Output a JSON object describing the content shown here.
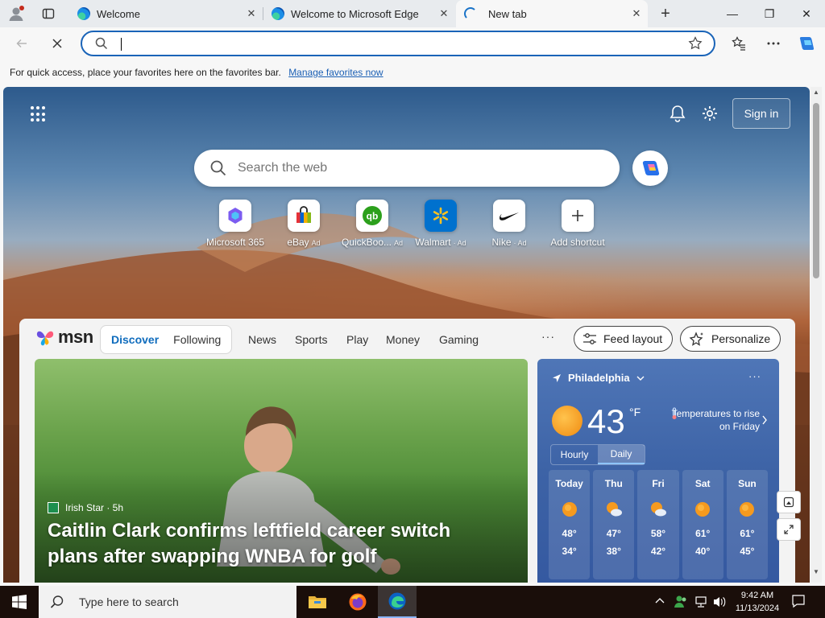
{
  "browser": {
    "tabs": [
      {
        "label": "Welcome"
      },
      {
        "label": "Welcome to Microsoft Edge"
      },
      {
        "label": "New tab"
      }
    ],
    "close_glyph": "✕",
    "new_tab_glyph": "+",
    "window_controls": {
      "minimize": "—",
      "maximize": "❐",
      "close": "✕"
    },
    "address": {
      "value": "",
      "placeholder": ""
    },
    "favorites_bar": {
      "message": "For quick access, place your favorites here on the favorites bar.",
      "link": "Manage favorites now"
    }
  },
  "newtab": {
    "sign_in": "Sign in",
    "search_placeholder": "Search the web",
    "shortcuts": [
      {
        "label": "Microsoft 365",
        "ad": "",
        "icon": "microsoft-365-icon"
      },
      {
        "label": "eBay",
        "ad": "Ad",
        "icon": "ebay-icon"
      },
      {
        "label": "QuickBoo...",
        "ad": "Ad",
        "icon": "quickbooks-icon"
      },
      {
        "label": "Walmart",
        "ad": "· Ad",
        "icon": "walmart-icon"
      },
      {
        "label": "Nike",
        "ad": "· Ad",
        "icon": "nike-icon"
      },
      {
        "label": "Add shortcut",
        "ad": "",
        "icon": "plus-icon"
      }
    ]
  },
  "feed": {
    "brand": "msn",
    "pills": [
      "Discover",
      "Following"
    ],
    "nav": [
      "News",
      "Sports",
      "Play",
      "Money",
      "Gaming"
    ],
    "more": "···",
    "feed_layout": "Feed layout",
    "personalize": "Personalize",
    "hero": {
      "source": "Irish Star · 5h",
      "title": "Caitlin Clark confirms leftfield career switch plans after swapping WNBA for golf"
    }
  },
  "weather": {
    "location": "Philadelphia",
    "temp": "43",
    "unit": "°F",
    "alert": "Temperatures to rise on Friday",
    "tabs": [
      "Hourly",
      "Daily"
    ],
    "selected_tab": "Daily",
    "days": [
      {
        "day": "Today",
        "hi": "48°",
        "lo": "34°",
        "icon": "sunny-icon"
      },
      {
        "day": "Thu",
        "hi": "47°",
        "lo": "38°",
        "icon": "partly-cloudy-icon"
      },
      {
        "day": "Fri",
        "hi": "58°",
        "lo": "42°",
        "icon": "partly-cloudy-icon"
      },
      {
        "day": "Sat",
        "hi": "61°",
        "lo": "40°",
        "icon": "sunny-icon"
      },
      {
        "day": "Sun",
        "hi": "61°",
        "lo": "45°",
        "icon": "sunny-icon"
      }
    ]
  },
  "taskbar": {
    "search_placeholder": "Type here to search",
    "time": "9:42 AM",
    "date": "11/13/2024"
  },
  "colors": {
    "accent": "#0f6cbd",
    "omnibox_border": "#1a64b8",
    "weather_bg": "#3d63a6"
  }
}
